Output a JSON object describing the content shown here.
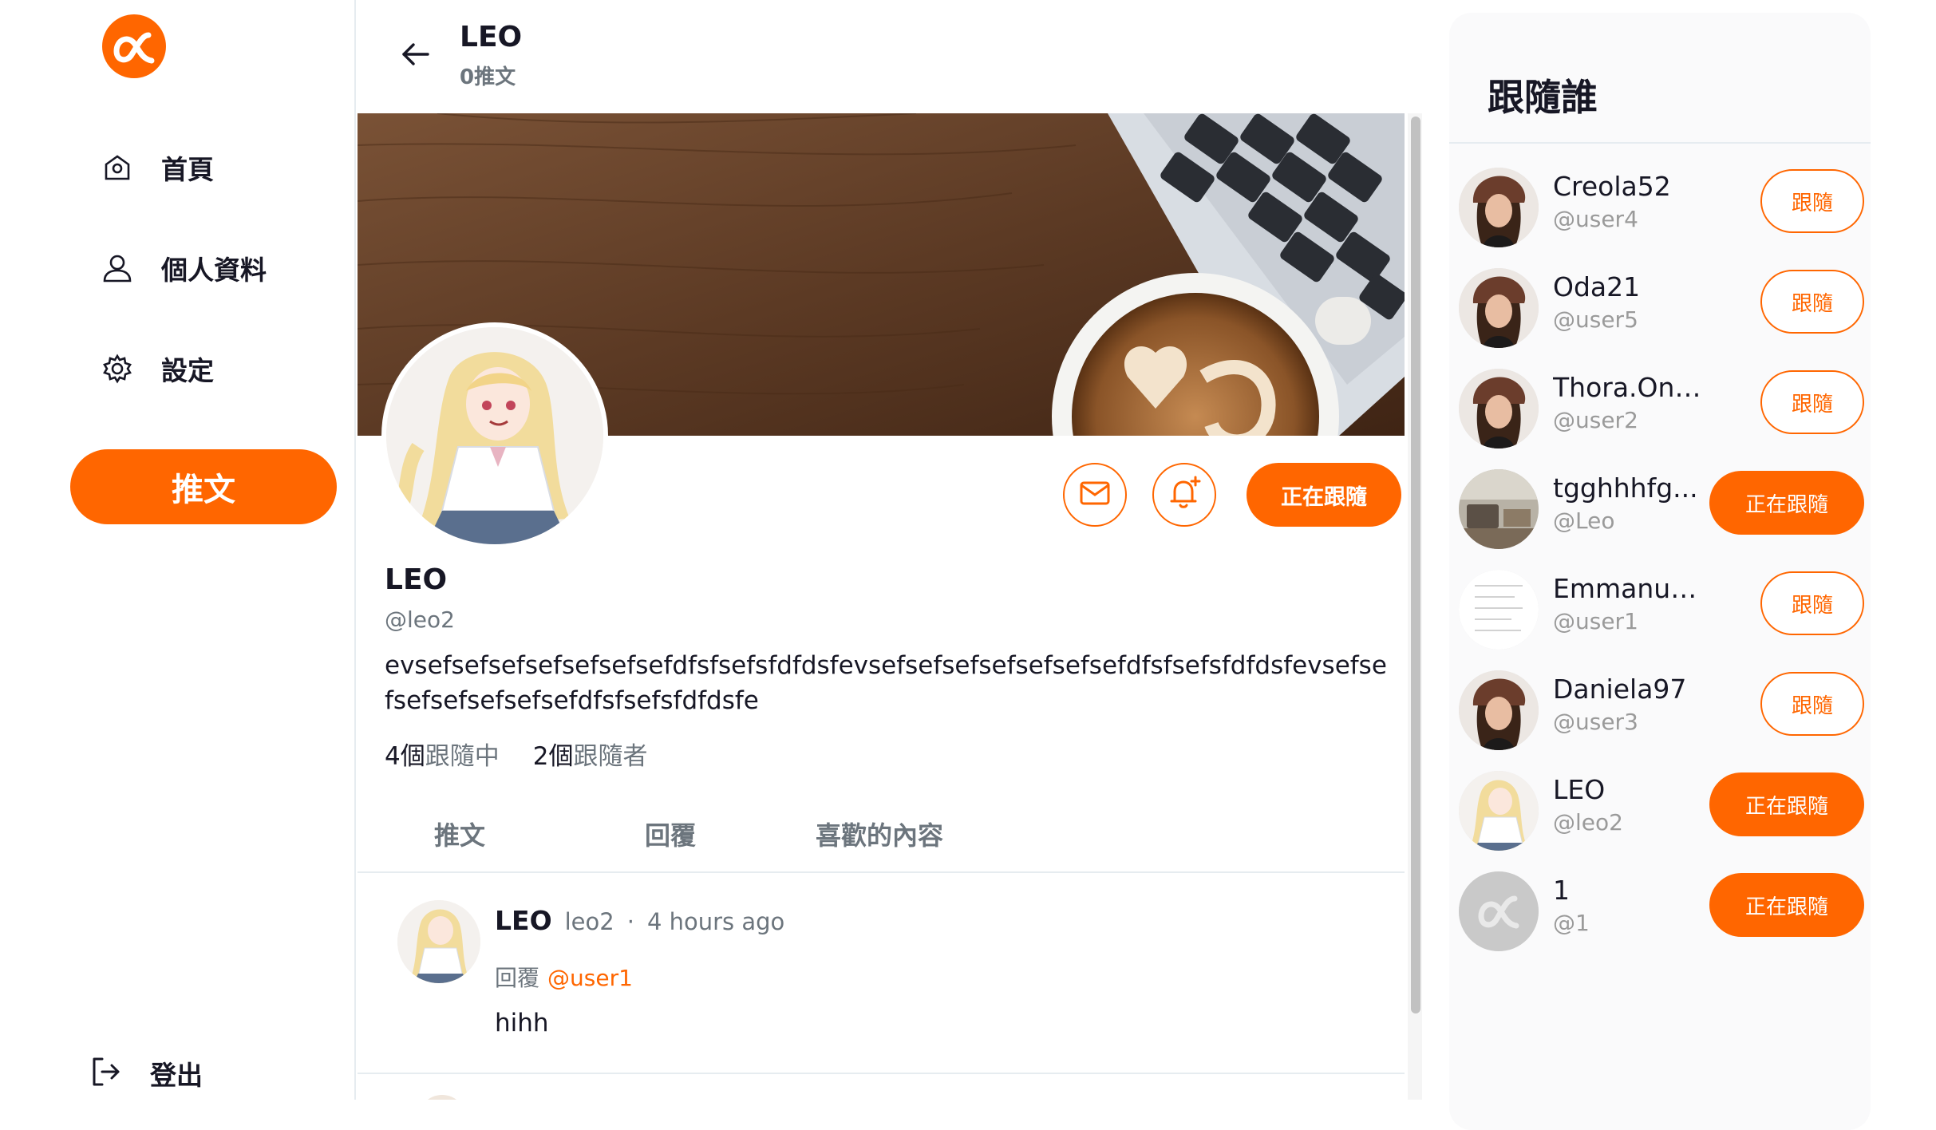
{
  "sidebar": {
    "nav": [
      {
        "label": "首頁",
        "icon": "home-icon"
      },
      {
        "label": "個人資料",
        "icon": "user-icon"
      },
      {
        "label": "設定",
        "icon": "gear-icon"
      }
    ],
    "tweet_button": "推文",
    "logout_label": "登出"
  },
  "header": {
    "name": "LEO",
    "tweet_count": "0推文"
  },
  "profile": {
    "name": "LEO",
    "handle": "@leo2",
    "bio": "evsefsefsefsefsefsefsefdfsfsefsfdfdsfevsefsefsefsefsefsefsefdfsfsefsfdfdsfevsefsefsefsefsefsefsefdfsfsefsfdfdsfe",
    "following_count": "4個",
    "following_label": "跟隨中",
    "followers_count": "2個",
    "followers_label": "跟隨者",
    "follow_state_button": "正在跟隨"
  },
  "tabs": [
    "推文",
    "回覆",
    "喜歡的內容"
  ],
  "post": {
    "name": "LEO",
    "handle": "leo2",
    "time": "4 hours ago",
    "reply_prefix": "回覆",
    "reply_to": "@user1",
    "body": "hihh"
  },
  "follow_panel": {
    "title": "跟隨誰",
    "users": [
      {
        "name": "Creola52",
        "handle": "@user4",
        "button": "跟隨",
        "following": false,
        "avatar": "woman-avatar"
      },
      {
        "name": "Oda21",
        "handle": "@user5",
        "button": "跟隨",
        "following": false,
        "avatar": "woman-avatar"
      },
      {
        "name": "Thora.Ond...",
        "handle": "@user2",
        "button": "跟隨",
        "following": false,
        "avatar": "woman-avatar"
      },
      {
        "name": "tgghhhfg...",
        "handle": "@Leo",
        "button": "正在跟隨",
        "following": true,
        "avatar": "desk-avatar"
      },
      {
        "name": "Emmanuel...",
        "handle": "@user1",
        "button": "跟隨",
        "following": false,
        "avatar": "document-avatar"
      },
      {
        "name": "Daniela97",
        "handle": "@user3",
        "button": "跟隨",
        "following": false,
        "avatar": "woman-avatar"
      },
      {
        "name": "LEO",
        "handle": "@leo2",
        "button": "正在跟隨",
        "following": true,
        "avatar": "anime-avatar"
      },
      {
        "name": "1",
        "handle": "@1",
        "button": "正在跟隨",
        "following": true,
        "avatar": "default-logo-avatar"
      }
    ]
  },
  "colors": {
    "accent": "#ff6600",
    "muted": "#6c757d",
    "text": "#171725"
  }
}
